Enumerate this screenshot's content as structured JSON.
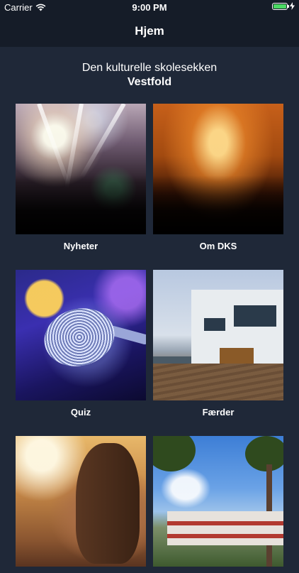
{
  "status_bar": {
    "carrier": "Carrier",
    "time": "9:00 PM",
    "icons": {
      "wifi": "wifi-icon",
      "battery": "battery-icon",
      "charging": "charging-bolt-icon"
    },
    "battery_color": "#4cd964"
  },
  "nav": {
    "title": "Hjem"
  },
  "header": {
    "line1": "Den kulturelle skolesekken",
    "line2": "Vestfold"
  },
  "tiles": [
    {
      "label": "Nyheter"
    },
    {
      "label": "Om DKS"
    },
    {
      "label": "Quiz"
    },
    {
      "label": "Færder"
    },
    {
      "label": ""
    },
    {
      "label": ""
    }
  ],
  "colors": {
    "background": "#1f2838",
    "bars": "#151c28",
    "text": "#ffffff"
  }
}
